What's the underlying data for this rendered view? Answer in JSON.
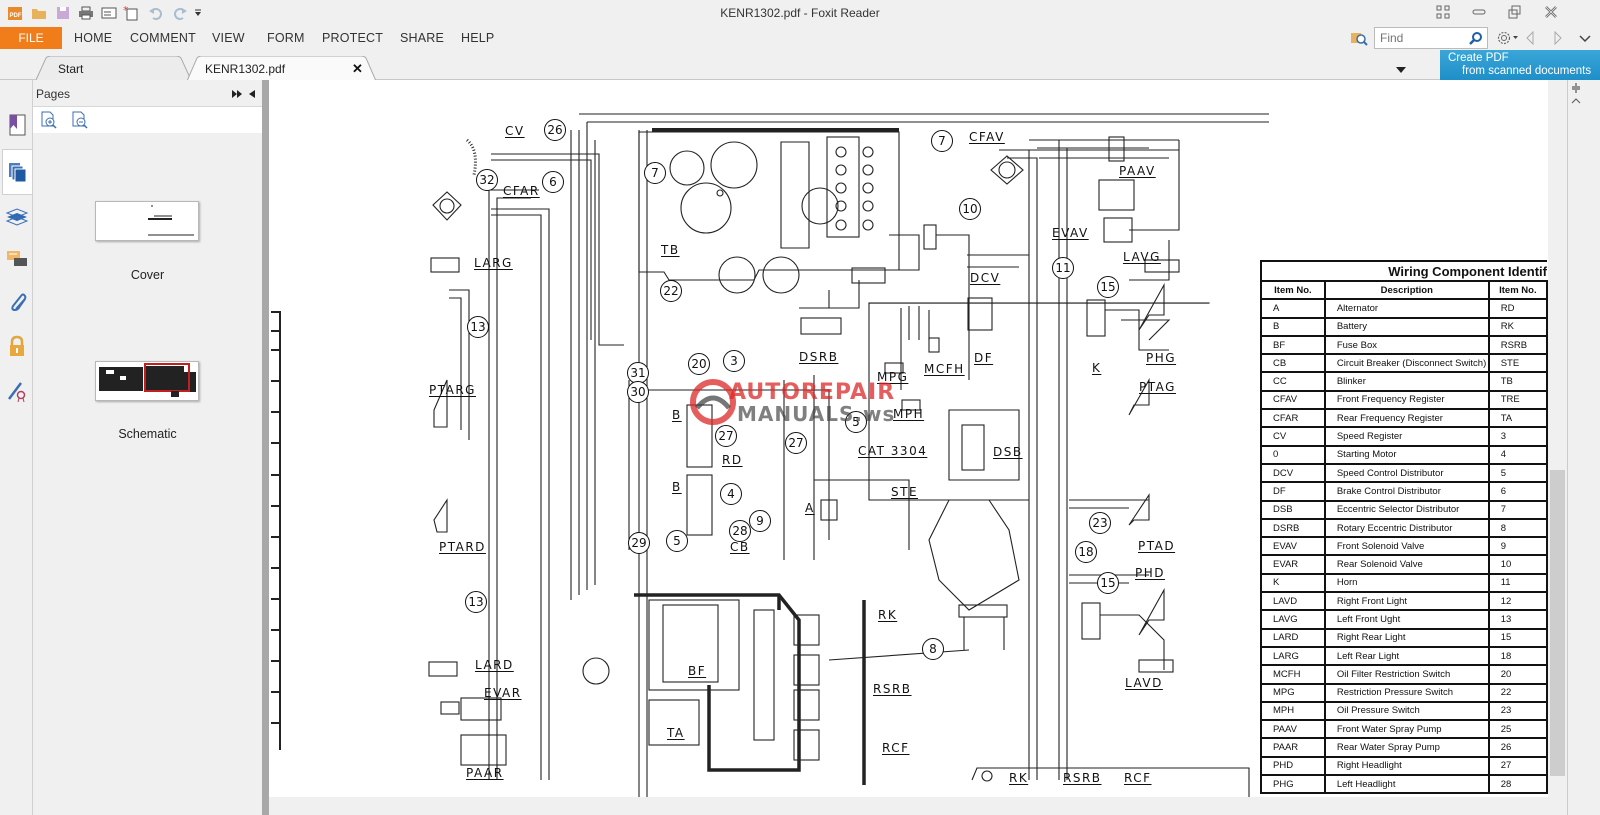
{
  "window": {
    "title": "KENR1302.pdf - Foxit Reader",
    "app_logo": "foxit-pdf-logo",
    "quick_access": [
      "open-folder-icon",
      "save-icon",
      "print-icon",
      "email-icon",
      "new-icon",
      "undo-icon",
      "redo-icon",
      "customize-dropdown-icon"
    ],
    "controls": [
      "fullscreen-icon",
      "minimize-icon",
      "restore-icon",
      "close-icon"
    ]
  },
  "menu": {
    "file": "FILE",
    "items": [
      "HOME",
      "COMMENT",
      "VIEW",
      "FORM",
      "PROTECT",
      "SHARE",
      "HELP"
    ]
  },
  "search": {
    "placeholder": "Find",
    "value": ""
  },
  "banner": {
    "line1": "Create PDF",
    "line2": "from scanned documents"
  },
  "tabs": [
    {
      "label": "Start",
      "active": false
    },
    {
      "label": "KENR1302.pdf",
      "active": true,
      "closable": true
    }
  ],
  "sidebar": {
    "panel_title": "Pages",
    "rail": [
      "bookmark-icon",
      "pages-icon",
      "layers-icon",
      "comments-icon",
      "attachments-icon",
      "security-icon",
      "signature-icon"
    ],
    "active_rail": "pages-icon",
    "tools": [
      "enlarge-thumbnails-icon",
      "reduce-thumbnails-icon"
    ],
    "pages": [
      {
        "label": "Cover"
      },
      {
        "label": "Schematic"
      }
    ]
  },
  "document": {
    "watermark": {
      "line1": "AUTOREPAIR",
      "line2": "MANUALS.ws"
    },
    "schematic_labels": [
      "CV",
      "CFAR",
      "LARG",
      "PTARG",
      "PTARD",
      "LARD",
      "EVAR",
      "PAAR",
      "TB",
      "DSRB",
      "MPG",
      "MCFH",
      "MPH",
      "DCV",
      "DF",
      "CFAV",
      "EVAV",
      "PAAV",
      "LAVG",
      "PHG",
      "K",
      "PTAG",
      "DSB",
      "CAT 3304",
      "STE",
      "A",
      "RD",
      "B",
      "B",
      "CB",
      "BF",
      "TA",
      "RK",
      "RSRB",
      "RCF",
      "PTAD",
      "PHD",
      "LAVD",
      "RK",
      "RSRB",
      "RCF"
    ],
    "callouts": [
      "26",
      "32",
      "6",
      "7",
      "22",
      "13",
      "20",
      "3",
      "31",
      "30",
      "27",
      "27",
      "4",
      "28",
      "29",
      "5",
      "9",
      "13",
      "5",
      "7",
      "10",
      "11",
      "15",
      "23",
      "18",
      "15",
      "8"
    ],
    "table": {
      "title": "Wiring Component Identif",
      "headers": [
        "Item No.",
        "Description",
        "Item No."
      ],
      "rows": [
        [
          "A",
          "Alternator",
          "RD"
        ],
        [
          "B",
          "Battery",
          "RK"
        ],
        [
          "BF",
          "Fuse Box",
          "RSRB"
        ],
        [
          "CB",
          "Circuit Breaker (Disconnect Switch)",
          "STE"
        ],
        [
          "CC",
          "Blinker",
          "TB"
        ],
        [
          "CFAV",
          "Front Frequency Register",
          "TRE"
        ],
        [
          "CFAR",
          "Rear Frequency Register",
          "TA"
        ],
        [
          "CV",
          "Speed Register",
          "3"
        ],
        [
          "0",
          "Starting Motor",
          "4"
        ],
        [
          "DCV",
          "Speed Control Distributor",
          "5"
        ],
        [
          "DF",
          "Brake Control Distributor",
          "6"
        ],
        [
          "DSB",
          "Eccentric Selector Distributor",
          "7"
        ],
        [
          "DSRB",
          "Rotary Eccentric Distributor",
          "8"
        ],
        [
          "EVAV",
          "Front Solenoid Valve",
          "9"
        ],
        [
          "EVAR",
          "Rear Solenoid Valve",
          "10"
        ],
        [
          "K",
          "Horn",
          "11"
        ],
        [
          "LAVD",
          "Right Front Light",
          "12"
        ],
        [
          "LAVG",
          "Left Front Ught",
          "13"
        ],
        [
          "LARD",
          "Right Rear Light",
          "15"
        ],
        [
          "LARG",
          "Left Rear Light",
          "18"
        ],
        [
          "MCFH",
          "Oil Filter Restriction Switch",
          "20"
        ],
        [
          "MPG",
          "Restriction Pressure Switch",
          "22"
        ],
        [
          "MPH",
          "Oil Pressure Switch",
          "23"
        ],
        [
          "PAAV",
          "Front Water Spray Pump",
          "25"
        ],
        [
          "PAAR",
          "Rear Water Spray Pump",
          "26"
        ],
        [
          "PHD",
          "Right Headlight",
          "27"
        ],
        [
          "PHG",
          "Left Headlight",
          "28"
        ]
      ]
    }
  }
}
